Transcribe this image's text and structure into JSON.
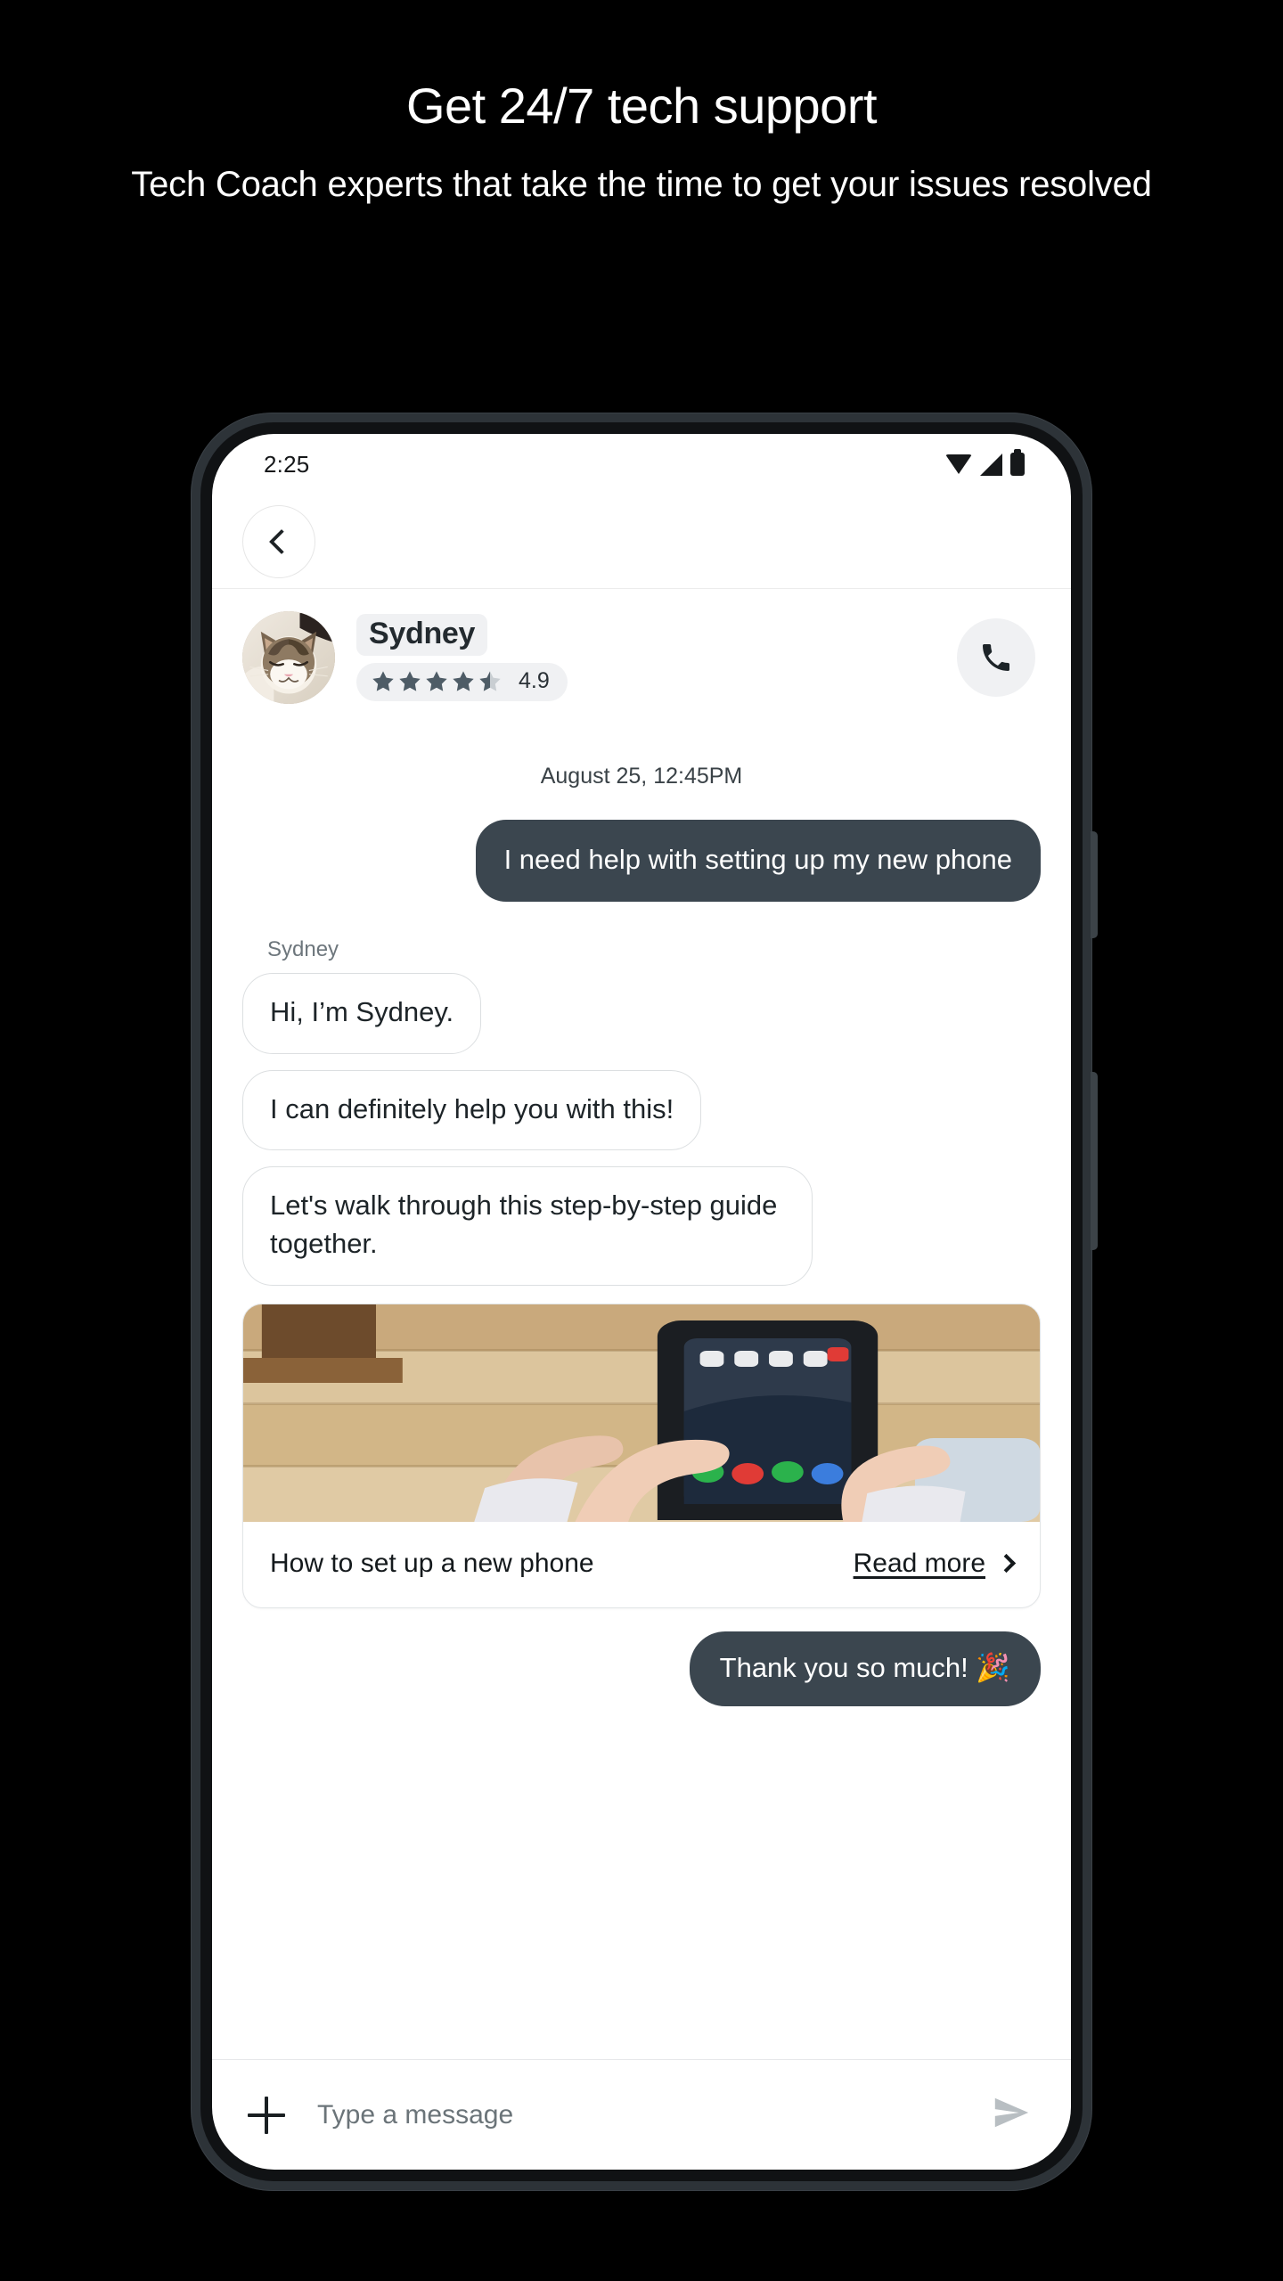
{
  "promo": {
    "title": "Get 24/7 tech support",
    "subtitle": "Tech Coach experts that take the time to get your issues resolved"
  },
  "status_bar": {
    "time": "2:25",
    "icons": [
      "wifi-icon",
      "cellular-signal-icon",
      "battery-icon"
    ]
  },
  "nav": {
    "back_icon": "chevron-left-icon"
  },
  "agent": {
    "name": "Sydney",
    "rating_value": "4.9",
    "stars_filled": 4,
    "stars_half": 1,
    "stars_total": 5,
    "avatar_alt": "cat-avatar",
    "call_icon": "phone-icon"
  },
  "thread": {
    "datestamp": "August 25, 12:45PM",
    "sender_label": "Sydney",
    "messages": [
      {
        "from": "user",
        "text": "I need help with setting up my new phone"
      },
      {
        "from": "agent",
        "text": "Hi, I’m Sydney."
      },
      {
        "from": "agent",
        "text": "I can definitely help you with this!"
      },
      {
        "from": "agent",
        "text": "Let's walk through this step-by-step guide together."
      },
      {
        "from": "user",
        "text": "Thank you so much! 🎉"
      }
    ]
  },
  "article_card": {
    "title": "How to set up a new phone",
    "link_label": "Read more",
    "chevron_icon": "chevron-right-icon",
    "image_alt": "hands-holding-smartphone-on-wooden-desk"
  },
  "composer": {
    "add_icon": "plus-icon",
    "placeholder": "Type a message",
    "value": "",
    "send_icon": "send-icon"
  },
  "colors": {
    "page_background": "#000000",
    "promo_text": "#ffffff",
    "bubble_out_bg": "#3b464f",
    "bubble_out_text": "#ffffff",
    "bubble_in_border": "#dcdfe1",
    "bubble_in_text": "#1d2428",
    "pill_bg": "#f0f1f3",
    "star_fill": "#4e5c66",
    "star_empty": "#c9ced2",
    "phone_frame": "#2d3338"
  }
}
